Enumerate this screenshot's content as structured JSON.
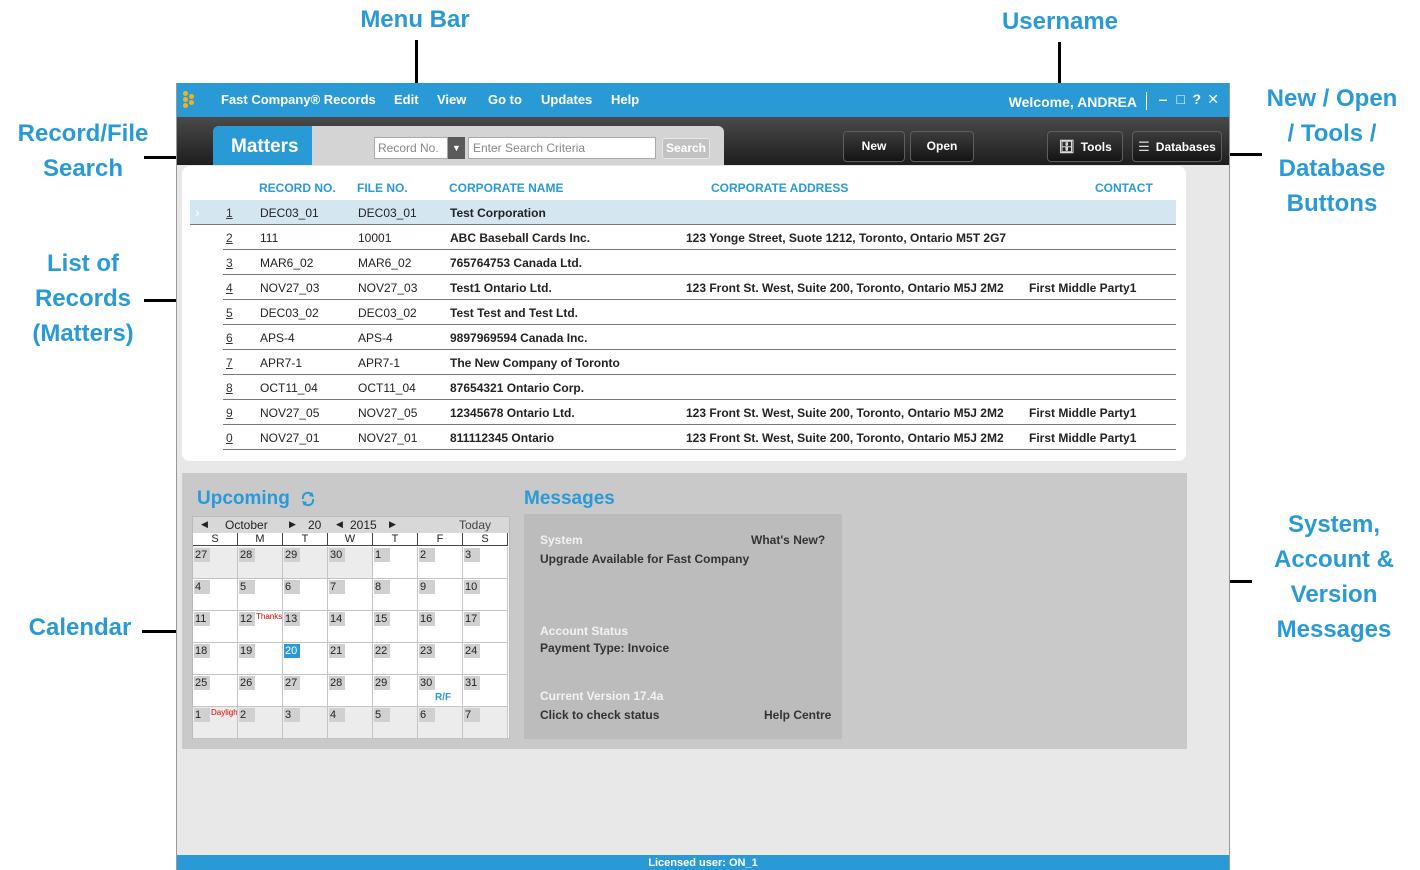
{
  "callouts": {
    "menu_bar": "Menu Bar",
    "username": "Username",
    "record_search": [
      "Record/File",
      "Search"
    ],
    "buttons": [
      "New / Open",
      "/ Tools /",
      "Database",
      "Buttons"
    ],
    "list": [
      "List of",
      "Records",
      "(Matters)"
    ],
    "calendar": "Calendar",
    "messages": [
      "System,",
      "Account &",
      "Version",
      "Messages"
    ]
  },
  "menu": {
    "app_title": "Fast Company® Records",
    "items": [
      "Edit",
      "View",
      "Go to",
      "Updates",
      "Help"
    ],
    "welcome": "Welcome, ANDREA"
  },
  "window_controls": [
    "‒",
    "□",
    "?",
    "✕"
  ],
  "search": {
    "tab_label": "Matters",
    "record_placeholder": "Record No.",
    "criteria_placeholder": "Enter Search Criteria",
    "button": "Search"
  },
  "buttons": {
    "new": "New",
    "open": "Open",
    "tools": "Tools",
    "databases": "Databases"
  },
  "table": {
    "columns": [
      "RECORD NO.",
      "FILE NO.",
      "CORPORATE NAME",
      "CORPORATE ADDRESS",
      "CONTACT"
    ],
    "rows": [
      {
        "num": "1",
        "record": "DEC03_01",
        "file": "DEC03_01",
        "name": "Test Corporation",
        "address": "",
        "contact": ""
      },
      {
        "num": "2",
        "record": "111",
        "file": "10001",
        "name": "ABC Baseball Cards Inc.",
        "address": "123 Yonge Street, Suote 1212, Toronto, Ontario M5T 2G7",
        "contact": ""
      },
      {
        "num": "3",
        "record": "MAR6_02",
        "file": "MAR6_02",
        "name": "765764753 Canada Ltd.",
        "address": "",
        "contact": ""
      },
      {
        "num": "4",
        "record": "NOV27_03",
        "file": "NOV27_03",
        "name": "Test1 Ontario Ltd.",
        "address": "123 Front St. West, Suite 200, Toronto, Ontario M5J 2M2",
        "contact": "First Middle Party1"
      },
      {
        "num": "5",
        "record": "DEC03_02",
        "file": "DEC03_02",
        "name": "Test Test and Test Ltd.",
        "address": "",
        "contact": ""
      },
      {
        "num": "6",
        "record": "APS-4",
        "file": "APS-4",
        "name": "9897969594 Canada Inc.",
        "address": "",
        "contact": ""
      },
      {
        "num": "7",
        "record": "APR7-1",
        "file": "APR7-1",
        "name": "The New Company of Toronto",
        "address": "",
        "contact": ""
      },
      {
        "num": "8",
        "record": "OCT11_04",
        "file": "OCT11_04",
        "name": "87654321 Ontario Corp.",
        "address": "",
        "contact": ""
      },
      {
        "num": "9",
        "record": "NOV27_05",
        "file": "NOV27_05",
        "name": "12345678 Ontario Ltd.",
        "address": "123 Front St. West, Suite 200, Toronto, Ontario M5J 2M2",
        "contact": "First Middle Party1"
      },
      {
        "num": "0",
        "record": "NOV27_01",
        "file": "NOV27_01",
        "name": "811112345 Ontario",
        "address": "123 Front St. West, Suite 200, Toronto, Ontario M5J 2M2",
        "contact": "First Middle Party1"
      }
    ]
  },
  "upcoming": {
    "title": "Upcoming",
    "month": "October",
    "day": "20",
    "year": "2015",
    "today": "Today",
    "dow": [
      "S",
      "M",
      "T",
      "W",
      "T",
      "F",
      "S"
    ],
    "weeks": [
      [
        "27",
        "28",
        "29",
        "30",
        "1",
        "2",
        "3"
      ],
      [
        "4",
        "5",
        "6",
        "7",
        "8",
        "9",
        "10"
      ],
      [
        "11",
        "12",
        "13",
        "14",
        "15",
        "16",
        "17"
      ],
      [
        "18",
        "19",
        "20",
        "21",
        "22",
        "23",
        "24"
      ],
      [
        "25",
        "26",
        "27",
        "28",
        "29",
        "30",
        "31"
      ],
      [
        "1",
        "2",
        "3",
        "4",
        "5",
        "6",
        "7"
      ]
    ],
    "thanksgiving": "Thanksgiving",
    "daylight": "Daylight",
    "rf": "R/F"
  },
  "messages": {
    "title": "Messages",
    "system": "System",
    "whats_new": "What's New?",
    "upgrade": "Upgrade Available for Fast Company",
    "account_status": "Account Status",
    "payment": "Payment Type: Invoice",
    "version": "Current Version 17.4a",
    "check": "Click to check status",
    "help": "Help Centre"
  },
  "status_bar": "Licensed user: ON_1"
}
